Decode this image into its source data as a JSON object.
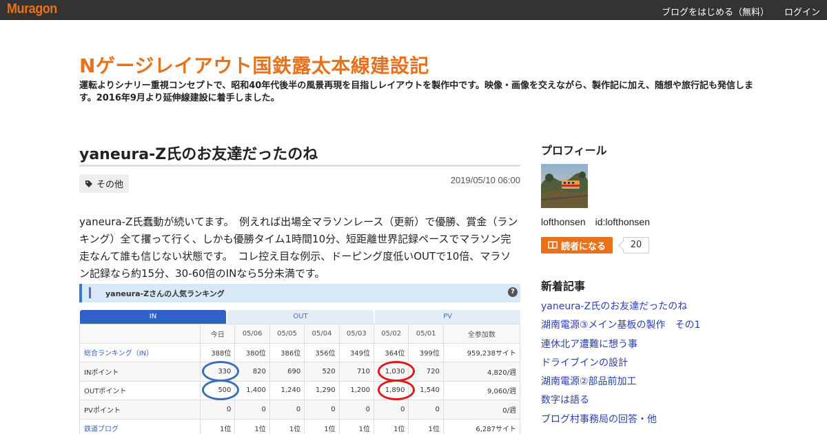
{
  "topbar": {
    "logo": "Muragon",
    "start_blog": "ブログをはじめる（無料）",
    "login": "ログイン"
  },
  "blog": {
    "title": "Nゲージレイアウト国鉄露太本線建設記",
    "description": "運転よりシナリー重視コンセプトで、昭和40年代後半の風景再現を目指しレイアウトを製作中です。映像・画像を交えながら、製作記に加え、随想や旅行記も発信します。2016年9月より延伸線建設に着手しました。"
  },
  "article": {
    "title": "yaneura-Z氏のお友達だったのね",
    "category": "その他",
    "date": "2019/05/10 06:00",
    "body": "yaneura-Z氏蠢動が続いてます。　例えれば出場全マラソンレース（更新）で優勝、賞金（ランキング）全て攫って行く、しかも優勝タイム1時間10分、短距離世界記録ペースでマラソン完走なんて誰も信じない状態です。　コレ控え目な例示、ドーピング度低いOUTで10倍、マラソン記録なら約15分、30-60倍のINなら5分未満です。"
  },
  "ranking": {
    "title": "yaneura-Zさんの人気ランキング",
    "help": "?",
    "tabs": [
      "IN",
      "OUT",
      "PV"
    ],
    "headers": [
      "",
      "今日",
      "05/06",
      "05/05",
      "05/04",
      "05/03",
      "05/02",
      "05/01",
      "全参加数"
    ],
    "rows": [
      [
        "総合ランキング（IN）",
        "388位",
        "380位",
        "386位",
        "356位",
        "349位",
        "364位",
        "399位",
        "959,238サイト"
      ],
      [
        "INポイント",
        "330",
        "820",
        "690",
        "520",
        "710",
        "1,030",
        "720",
        "4,820/週"
      ],
      [
        "OUTポイント",
        "500",
        "1,400",
        "1,240",
        "1,290",
        "1,200",
        "1,890",
        "1,540",
        "9,060/週"
      ],
      [
        "PVポイント",
        "0",
        "0",
        "0",
        "0",
        "0",
        "0",
        "0",
        "0/週"
      ],
      [
        "鉄道ブログ",
        "1位",
        "1位",
        "1位",
        "1位",
        "1位",
        "1位",
        "1位",
        "6,287サイト"
      ]
    ]
  },
  "sidebar": {
    "profile_heading": "プロフィール",
    "profile_name": "lofthonsen　id:lofthonsen",
    "reader_button": "読者になる",
    "reader_count": "20",
    "recent_heading": "新着記事",
    "recent": [
      "yaneura-Z氏のお友達だったのね",
      "湖南電源③メイン基板の製作　その1",
      "連休北ア遭難に想う事",
      "ドライブインの設計",
      "湖南電源②部品前加工",
      "数字は語る",
      "ブログ村事務局の回答・他"
    ]
  },
  "colors": {
    "accent": "#e8721c",
    "link": "#2b3fb0",
    "topbar": "#333333",
    "tab_active": "#2e62c4",
    "circle_blue": "#3a6fb8",
    "circle_red": "#e01818"
  }
}
